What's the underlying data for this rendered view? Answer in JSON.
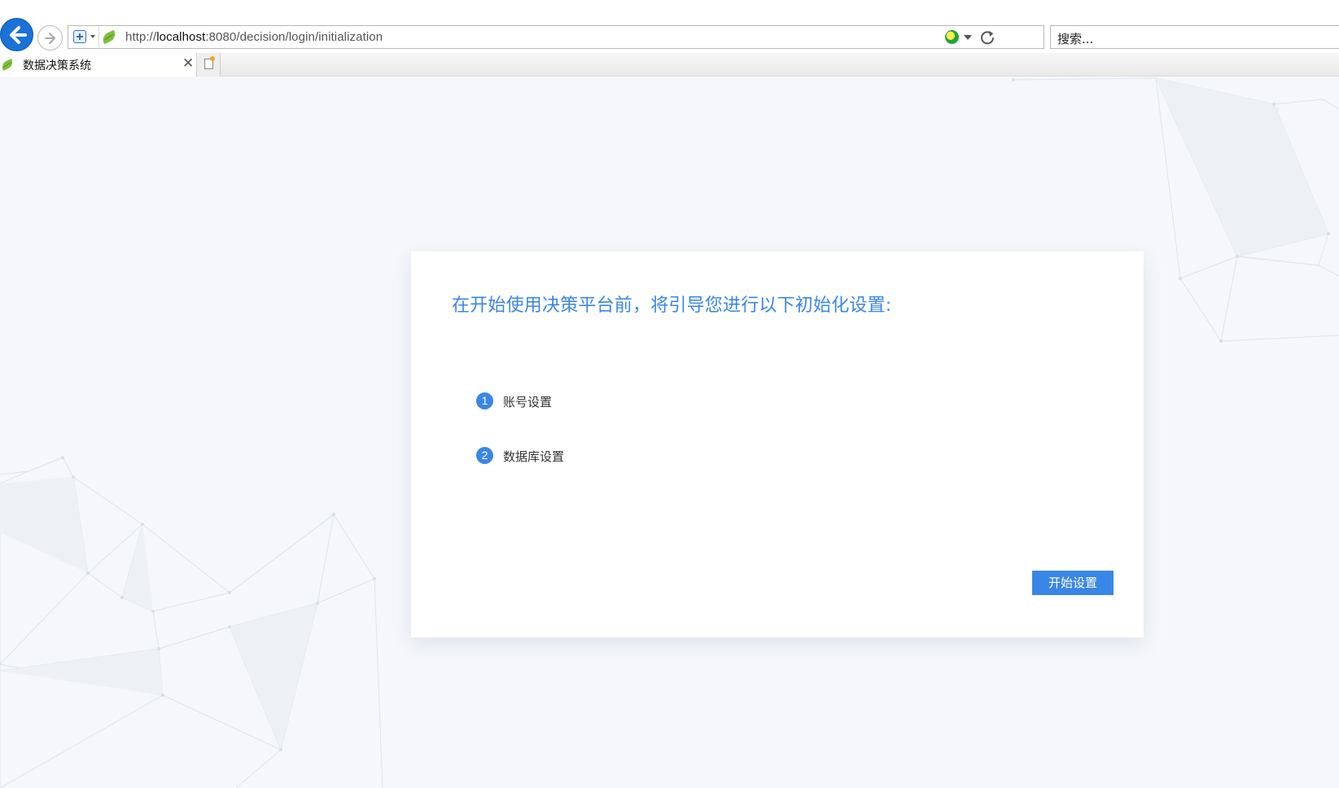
{
  "browser": {
    "url_scheme": "http://",
    "url_host": "localhost",
    "url_rest": ":8080/decision/login/initialization",
    "search_placeholder": "搜索...",
    "tab_title": "数据决策系统",
    "tab_close_glyph": "✕"
  },
  "init": {
    "title": "在开始使用决策平台前，将引导您进行以下初始化设置:",
    "steps": [
      {
        "number": "1",
        "label": "账号设置"
      },
      {
        "number": "2",
        "label": "数据库设置"
      }
    ],
    "start_button": "开始设置"
  },
  "colors": {
    "accent": "#3a86e6",
    "background": "#f5f7fa"
  },
  "icons": [
    "back-arrow-icon",
    "forward-arrow-icon",
    "site-shield-icon",
    "leaf-favicon-icon",
    "compatibility-icon",
    "dropdown-arrow-icon",
    "refresh-icon",
    "close-icon",
    "new-tab-icon"
  ]
}
